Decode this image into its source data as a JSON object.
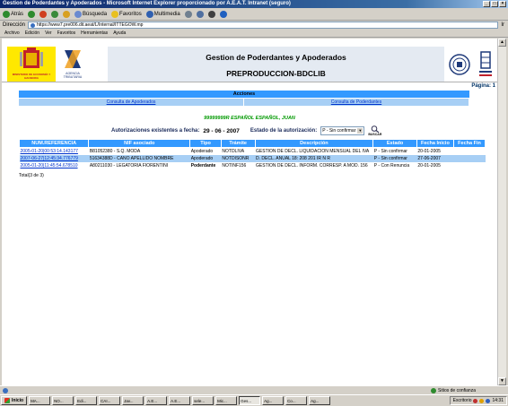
{
  "window": {
    "title": "Gestion de Poderdantes y Apoderados - Microsoft Internet Explorer proporcionado por A.E.A.T. Intranet (seguro)"
  },
  "toolbar": {
    "back": "Atrás",
    "search": "Búsqueda",
    "favorites": "Favoritos",
    "multimedia": "Multimedia"
  },
  "address": {
    "label": "Dirección",
    "url": "https://www7.pre006.dit.aeat/L/Internal/ITTEGOW.mp",
    "go": "Ir"
  },
  "menu": [
    "Archivo",
    "Edición",
    "Ver",
    "Favoritos",
    "Herramientas",
    "Ayuda"
  ],
  "header": {
    "logo_left_text": "MINISTERIO DE ECONOMÍA Y HACIENDA",
    "logo_agency_text": "AGENCIA TRIBUTARIA",
    "title": "Gestion de Poderdantes y Apoderados",
    "subtitle": "PREPRODUCCION-BDCLIB"
  },
  "pagina": "Página: 1",
  "acciones": {
    "title": "Acciones",
    "links": [
      "Consulta de Apoderados",
      "Consulta de Poderdantes"
    ]
  },
  "usuario": "99999999R ESPAÑOL ESPAÑOL, JUAN",
  "filters": {
    "date_label": "Autorizaciones existentes a fecha:",
    "date_value": "29 - 06 - 2007",
    "estado_label": "Estado de la autorización:",
    "estado_value": "P - Sin confirmar",
    "search_label": "BUSCAR"
  },
  "table": {
    "headers": [
      "NUM.REFERENCIA",
      "NIF asociado",
      "Tipo",
      "Trámite",
      "Descripción",
      "Estado",
      "Fecha Inicio",
      "Fecha Fin"
    ],
    "rows": [
      [
        "2005-01-20|00:53:14.143177",
        "B81052380 - S.Q. MODA",
        "Apoderado",
        "NOTDLIVA",
        "GESTION DE DECL. LIQUIDACION MENSUAL DEL IVA",
        "P - Sin confirmar",
        "20-01-2005",
        ""
      ],
      [
        "2007-06-27|12:45:34.776779",
        "51634388D - CANO APELLIDO NOMBRE",
        "Apoderado",
        "NOTDISONR",
        "D. DECL. ANUAL 18: 208 201 IR N R",
        "P - Sin confirmar",
        "27-06-2007",
        ""
      ],
      [
        "2005-01-20|11:45:54.678510",
        "A80211030 - LEGATORIA FIORENTINI",
        "Poderdante",
        "NOTINF156",
        "GESTION DE DECL. INFORM. CORRESP. A MOD. 156",
        "P - Con Renuncia",
        "20-01-2005",
        ""
      ]
    ],
    "total": "Total(3 de 3)"
  },
  "statusbar": {
    "zone": "Sitios de confianza"
  },
  "taskbar": {
    "start": "Inicio",
    "tasks": [
      "MA...",
      "NO...",
      "Edi...",
      "CAI...",
      "Jav...",
      "A.E...",
      "A.E...",
      "sele...",
      "Mic...",
      "Ges...",
      "Ag...",
      "Co...",
      "Ag...",
      "A.E...",
      "Ag..."
    ],
    "tray_label": "Escritorio",
    "clock": "14:31"
  },
  "colors": {
    "header_blue": "#3399ff",
    "row_highlight": "#a7cff5",
    "user_green": "#009900"
  }
}
